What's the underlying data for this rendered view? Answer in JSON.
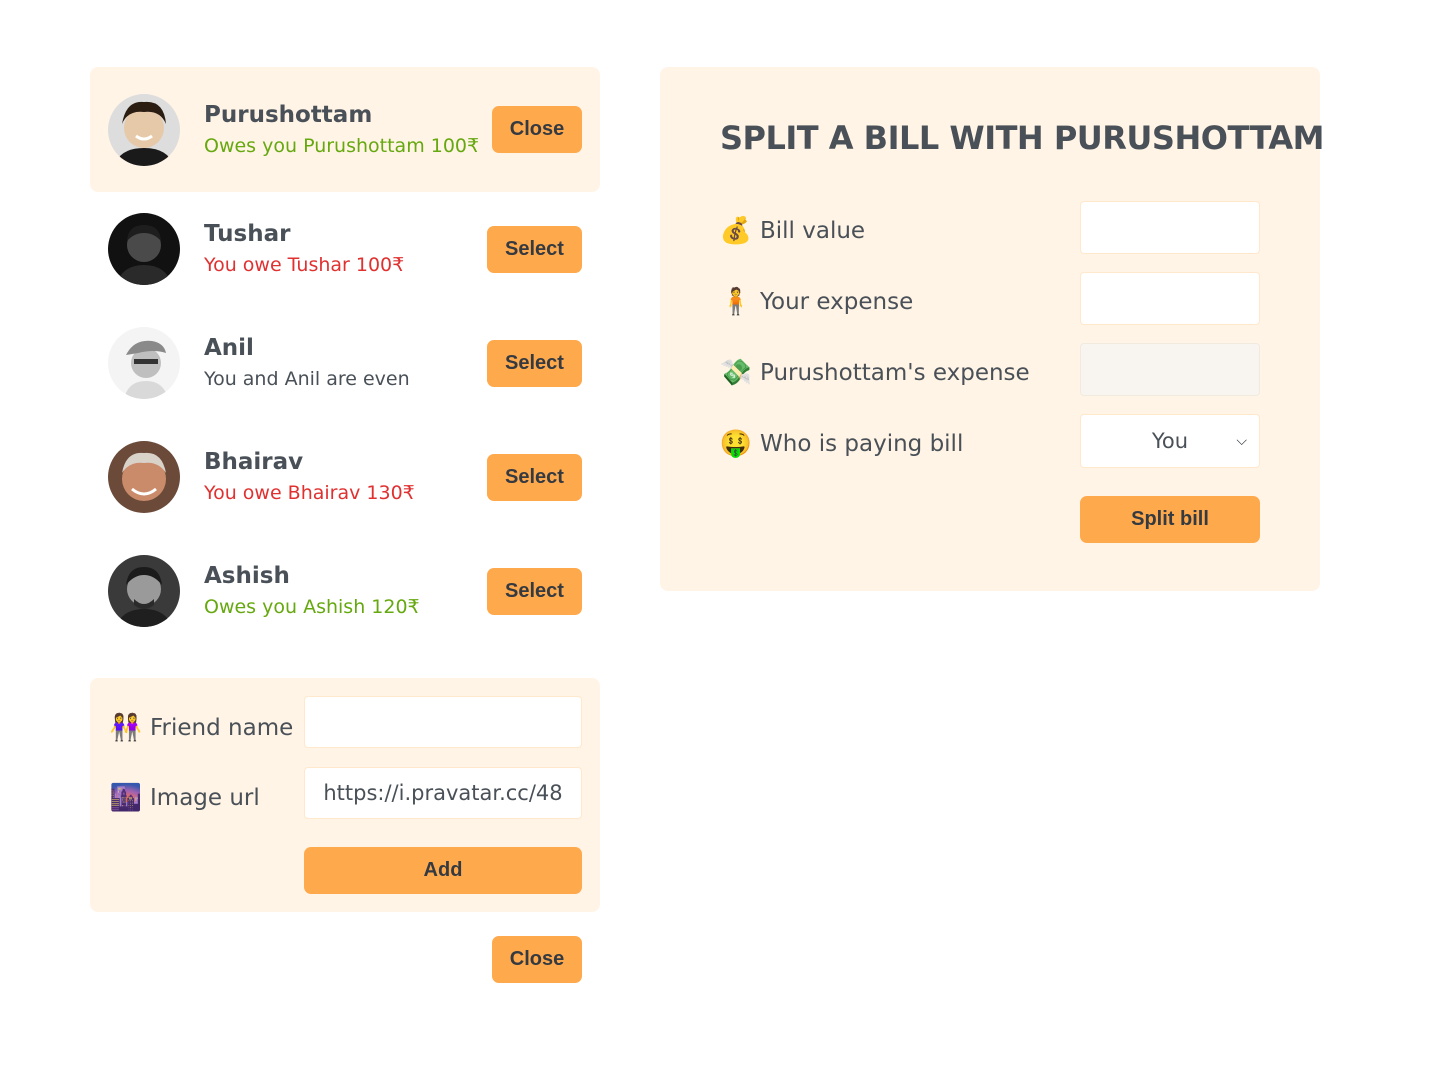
{
  "friends": [
    {
      "name": "Purushottam",
      "status": "Owes you Purushottam 100₹",
      "status_type": "owes-you",
      "button": "Close",
      "selected": true,
      "avatar": "person-photo"
    },
    {
      "name": "Tushar",
      "status": "You owe Tushar 100₹",
      "status_type": "you-owe",
      "button": "Select",
      "selected": false,
      "avatar": "person-photo"
    },
    {
      "name": "Anil",
      "status": "You and Anil are even",
      "status_type": "even",
      "button": "Select",
      "selected": false,
      "avatar": "person-photo"
    },
    {
      "name": "Bhairav",
      "status": "You owe Bhairav 130₹",
      "status_type": "you-owe",
      "button": "Select",
      "selected": false,
      "avatar": "person-photo"
    },
    {
      "name": "Ashish",
      "status": "Owes you Ashish 120₹",
      "status_type": "owes-you",
      "button": "Select",
      "selected": false,
      "avatar": "person-photo"
    }
  ],
  "add_form": {
    "name_icon": "👭",
    "name_label": "Friend name",
    "name_value": "",
    "image_icon": "🌆",
    "image_label": "Image url",
    "image_value": "https://i.pravatar.cc/48",
    "add_label": "Add"
  },
  "close_label": "Close",
  "split": {
    "title": "SPLIT A BILL WITH PURUSHOTTAM",
    "bill_icon": "💰",
    "bill_label": "Bill value",
    "bill_value": "",
    "your_icon": "🧍",
    "your_label": "Your expense",
    "your_value": "",
    "friend_icon": "💸",
    "friend_label": "Purushottam's expense",
    "friend_value": "",
    "payer_icon": "🤑",
    "payer_label": "Who is paying bill",
    "payer_value": "You",
    "split_label": "Split bill"
  },
  "colors": {
    "accent": "#ffa94d",
    "panel": "#fff4e6",
    "green": "#66a80f",
    "red": "#e03131",
    "text": "#495057"
  }
}
